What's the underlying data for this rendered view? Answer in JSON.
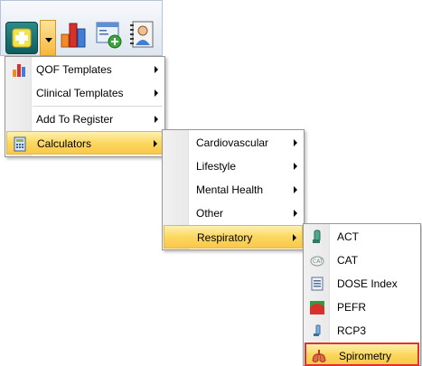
{
  "toolbar": {
    "buttons": [
      "add-icon",
      "dropdown-arrow-icon",
      "bar-chart-icon",
      "add-form-icon",
      "contacts-icon"
    ]
  },
  "menu1": {
    "items": [
      {
        "label": "QOF Templates",
        "icon": "bar-chart-icon",
        "submenu": true
      },
      {
        "label": "Clinical Templates",
        "icon": "",
        "submenu": true
      },
      {
        "label": "Add To Register",
        "icon": "",
        "submenu": true
      },
      {
        "label": "Calculators",
        "icon": "calculator-icon",
        "submenu": true,
        "highlighted": true
      }
    ]
  },
  "menu2": {
    "items": [
      {
        "label": "Cardiovascular",
        "submenu": true
      },
      {
        "label": "Lifestyle",
        "submenu": true
      },
      {
        "label": "Mental Health",
        "submenu": true
      },
      {
        "label": "Other",
        "submenu": true
      },
      {
        "label": "Respiratory",
        "submenu": true,
        "highlighted": true
      }
    ]
  },
  "menu3": {
    "items": [
      {
        "label": "ACT",
        "icon": "inhaler-icon"
      },
      {
        "label": "CAT",
        "icon": "cat-icon"
      },
      {
        "label": "DOSE Index",
        "icon": "form-icon"
      },
      {
        "label": "PEFR",
        "icon": "pefr-chart-icon"
      },
      {
        "label": "RCP3",
        "icon": "inhaler-small-icon"
      },
      {
        "label": "Spirometry",
        "icon": "lungs-icon",
        "highlighted": true
      }
    ]
  }
}
